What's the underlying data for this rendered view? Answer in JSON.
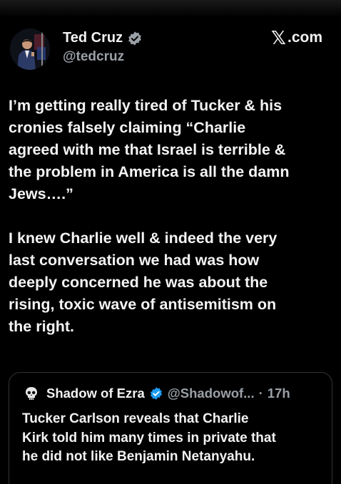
{
  "author": {
    "name": "Ted Cruz",
    "handle": "@tedcruz",
    "avatar_icon": "profile-photo",
    "verified_icon": "verified-badge-icon",
    "verified_color": "#9aa0a6"
  },
  "source": {
    "logo_glyph": "𝕏",
    "label": ".com"
  },
  "tweet": {
    "paragraph_1": "I’m getting really tired of Tucker & his\ncronies falsely claiming “Charlie\nagreed with me that Israel is terrible &\nthe problem in America is all the damn\nJews….”",
    "paragraph_2": "I knew Charlie well & indeed the very\nlast conversation we had was how\ndeeply concerned he was about the\nrising, toxic wave of antisemitism on\nthe right."
  },
  "quoted_post": {
    "avatar_icon": "skull-icon",
    "name": "Shadow of Ezra",
    "verified_icon": "verified-badge-icon",
    "verified_color": "#1d9bf0",
    "handle": "@Shadowof...",
    "separator": "·",
    "time": "17h",
    "text": "Tucker Carlson reveals that Charlie\nKirk told him many times in private that\nhe did not like Benjamin Netanyahu."
  },
  "colors": {
    "background": "#000000",
    "text": "#f2f2f2",
    "secondary": "#9aa0a6",
    "border": "#2f3336"
  }
}
